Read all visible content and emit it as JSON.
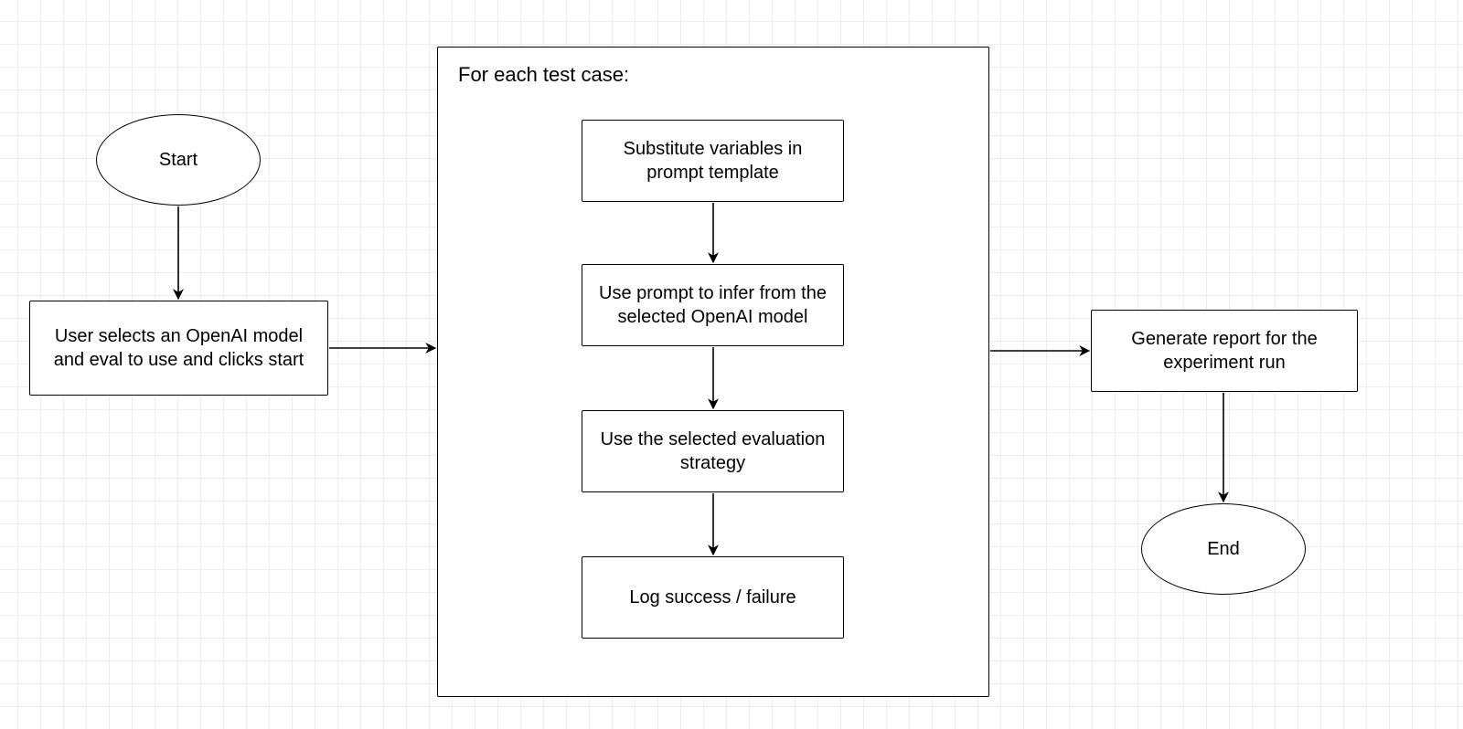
{
  "nodes": {
    "start": "Start",
    "user_select": "User selects an OpenAI model and eval to use and clicks start",
    "container_title": "For each test case:",
    "step1": "Substitute variables in prompt template",
    "step2": "Use prompt to infer from the selected OpenAI model",
    "step3": "Use the selected evaluation strategy",
    "step4": "Log success / failure",
    "report": "Generate report for the experiment run",
    "end": "End"
  }
}
